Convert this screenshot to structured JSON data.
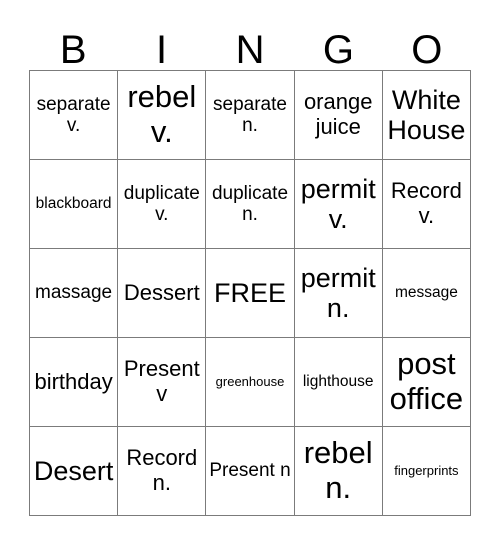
{
  "card": {
    "header_letters": [
      "B",
      "I",
      "N",
      "G",
      "O"
    ],
    "columns": 5,
    "rows": 5,
    "free_space_label": "FREE",
    "border_color": "#7b7b7b",
    "text_color": "#000000",
    "background_color": "#ffffff",
    "cells": [
      [
        {
          "text": "separate v.",
          "size": "sz-m"
        },
        {
          "text": "rebel v.",
          "size": "sz-xxl"
        },
        {
          "text": "separate n.",
          "size": "sz-m"
        },
        {
          "text": "orange juice",
          "size": "sz-l"
        },
        {
          "text": "White House",
          "size": "sz-xl"
        }
      ],
      [
        {
          "text": "blackboard",
          "size": "sz-s"
        },
        {
          "text": "duplicate v.",
          "size": "sz-m"
        },
        {
          "text": "duplicate n.",
          "size": "sz-m"
        },
        {
          "text": "permit v.",
          "size": "sz-xl"
        },
        {
          "text": "Record v.",
          "size": "sz-l"
        }
      ],
      [
        {
          "text": "massage",
          "size": "sz-m"
        },
        {
          "text": "Dessert",
          "size": "sz-l"
        },
        {
          "text": "FREE",
          "size": "sz-xl"
        },
        {
          "text": "permit n.",
          "size": "sz-xl"
        },
        {
          "text": "message",
          "size": "sz-s"
        }
      ],
      [
        {
          "text": "birthday",
          "size": "sz-l"
        },
        {
          "text": "Present v",
          "size": "sz-l"
        },
        {
          "text": "greenhouse",
          "size": "sz-xs"
        },
        {
          "text": "lighthouse",
          "size": "sz-s"
        },
        {
          "text": "post office",
          "size": "sz-xxl"
        }
      ],
      [
        {
          "text": "Desert",
          "size": "sz-xl"
        },
        {
          "text": "Record n.",
          "size": "sz-l"
        },
        {
          "text": "Present n",
          "size": "sz-m"
        },
        {
          "text": "rebel n.",
          "size": "sz-xxl"
        },
        {
          "text": "fingerprints",
          "size": "sz-xs"
        }
      ]
    ]
  }
}
